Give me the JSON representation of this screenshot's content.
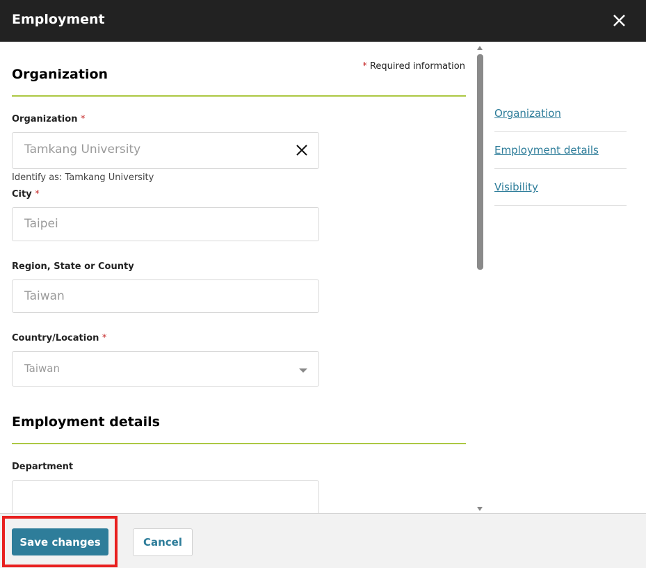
{
  "dialog": {
    "title": "Employment",
    "close_icon": "close-icon"
  },
  "required_info": {
    "star": "*",
    "text": "Required information"
  },
  "sections": {
    "organization": {
      "title": "Organization"
    },
    "employment_details": {
      "title": "Employment details"
    }
  },
  "fields": {
    "organization": {
      "label": "Organization",
      "required": "*",
      "value": "Tamkang University",
      "hint": "Identify as: Tamkang University"
    },
    "city": {
      "label": "City",
      "required": "*",
      "value": "Taipei"
    },
    "region": {
      "label": "Region, State or County",
      "value": "Taiwan"
    },
    "country": {
      "label": "Country/Location",
      "required": "*",
      "value": "Taiwan"
    },
    "department": {
      "label": "Department",
      "value": ""
    }
  },
  "side_nav": {
    "items": [
      {
        "label": "Organization"
      },
      {
        "label": "Employment details"
      },
      {
        "label": "Visibility"
      }
    ]
  },
  "footer": {
    "save_label": "Save changes",
    "cancel_label": "Cancel"
  },
  "colors": {
    "header_bg": "#222222",
    "accent": "#2e7d9a",
    "section_rule": "#acc843",
    "required": "#c62828",
    "highlight": "#e8201f"
  }
}
